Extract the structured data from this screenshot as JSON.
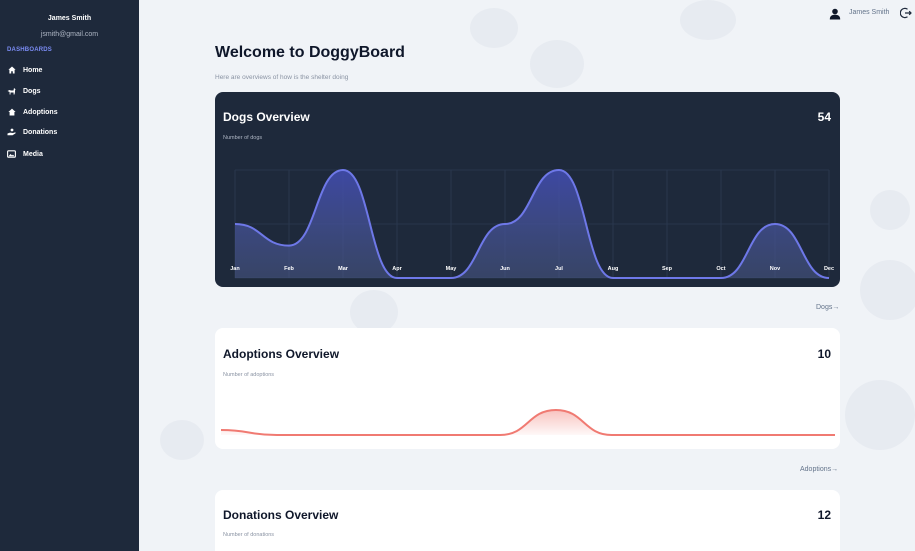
{
  "user": {
    "name": "James Smith",
    "email": "jsmith@gmail.com"
  },
  "sidebar": {
    "section": "DASHBOARDS",
    "items": [
      {
        "label": "Home",
        "icon": "home-icon"
      },
      {
        "label": "Dogs",
        "icon": "dog-icon"
      },
      {
        "label": "Adoptions",
        "icon": "house-icon"
      },
      {
        "label": "Donations",
        "icon": "donation-hand-icon"
      },
      {
        "label": "Media",
        "icon": "image-icon"
      }
    ]
  },
  "topbar": {
    "user_name": "James  Smith"
  },
  "page": {
    "title": "Welcome to DoggyBoard",
    "subtitle": "Here are overviews of how is the shelter doing"
  },
  "cards": {
    "dogs": {
      "title": "Dogs Overview",
      "count": "54",
      "subtitle": "Number of dogs",
      "link": "Dogs→"
    },
    "adoptions": {
      "title": "Adoptions Overview",
      "count": "10",
      "subtitle": "Number of adoptions",
      "link": "Adoptions→"
    },
    "donations": {
      "title": "Donations Overview",
      "count": "12",
      "subtitle": "Number of donations"
    }
  },
  "colors": {
    "sidebar_bg": "#1e293b",
    "accent": "#7b8cf5",
    "dogs_line": "#6e78e8",
    "adoptions_line": "#f07a72"
  },
  "chart_data": [
    {
      "type": "area",
      "x": [
        "Jan",
        "Feb",
        "Mar",
        "Apr",
        "May",
        "Jun",
        "Jul",
        "Aug",
        "Sep",
        "Oct",
        "Nov",
        "Dec"
      ],
      "series": [
        {
          "values": [
            5,
            3,
            10,
            0,
            0,
            5,
            10,
            0,
            0,
            0,
            5,
            0
          ]
        }
      ],
      "ylim": [
        0,
        10
      ],
      "grid": true
    },
    {
      "type": "area",
      "x": [
        1,
        2,
        3,
        4,
        5,
        6,
        7,
        8,
        9,
        10,
        11,
        12
      ],
      "series": [
        {
          "values": [
            0.2,
            0,
            0,
            0,
            0,
            0,
            1,
            0,
            0,
            0,
            0,
            0
          ]
        }
      ],
      "ylim": [
        0,
        1
      ],
      "grid": false
    }
  ]
}
